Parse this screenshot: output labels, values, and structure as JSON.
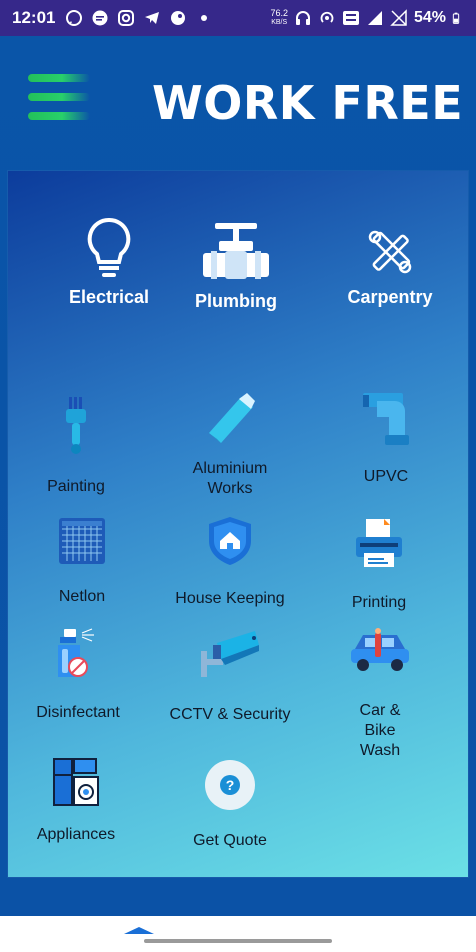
{
  "status_bar": {
    "time": "12:01",
    "net_speed": "76.2",
    "net_unit": "KB/S",
    "battery": "54%",
    "icons": [
      "whatsapp-icon",
      "chat-icon",
      "instagram-icon",
      "telegram-icon",
      "app-icon",
      "dot-icon",
      "headphones-icon",
      "hotspot-icon",
      "volte-icon",
      "signal-4g-icon",
      "no-signal-icon",
      "battery-icon"
    ]
  },
  "header": {
    "title": "WORK FREE"
  },
  "services_top": [
    {
      "label": "Electrical",
      "icon": "bulb-icon"
    },
    {
      "label": "Plumbing",
      "icon": "pipe-valve-icon"
    },
    {
      "label": "Carpentry",
      "icon": "tools-icon"
    }
  ],
  "services": [
    {
      "label": "Painting",
      "icon": "paintbrush-icon"
    },
    {
      "label": "Aluminium Works",
      "icon": "aluminium-icon"
    },
    {
      "label": "UPVC",
      "icon": "pipe-elbow-icon"
    },
    {
      "label": "Netlon",
      "icon": "mesh-icon"
    },
    {
      "label": "House Keeping",
      "icon": "shield-home-icon"
    },
    {
      "label": "Printing",
      "icon": "printer-icon"
    },
    {
      "label": "Disinfectant",
      "icon": "spray-icon"
    },
    {
      "label": "CCTV & Security",
      "icon": "cctv-icon"
    },
    {
      "label": "Car & Bike Wash",
      "icon": "car-wash-icon"
    },
    {
      "label": "Appliances",
      "icon": "appliances-icon"
    },
    {
      "label": "Get Quote",
      "icon": "question-icon"
    }
  ]
}
